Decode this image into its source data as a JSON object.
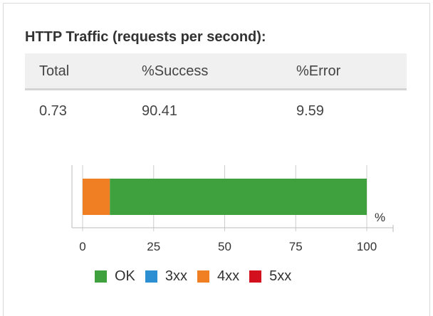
{
  "title": "HTTP Traffic (requests per second):",
  "table": {
    "headers": [
      "Total",
      "%Success",
      "%Error"
    ],
    "row": [
      "0.73",
      "90.41",
      "9.59"
    ]
  },
  "chart_data": {
    "type": "bar",
    "orientation": "horizontal",
    "stacked": true,
    "xlim": [
      0,
      100
    ],
    "x_ticks": [
      "0",
      "25",
      "50",
      "75",
      "100"
    ],
    "unit_label": "%",
    "series": [
      {
        "name": "4xx",
        "values": [
          9.59
        ],
        "color": "#ef7f22"
      },
      {
        "name": "OK",
        "values": [
          90.41
        ],
        "color": "#3fa03e"
      }
    ],
    "legend": [
      {
        "name": "OK",
        "color": "#3fa03e"
      },
      {
        "name": "3xx",
        "color": "#2b8fd1"
      },
      {
        "name": "4xx",
        "color": "#ef7f22"
      },
      {
        "name": "5xx",
        "color": "#d2101e"
      }
    ],
    "legend_position": "bottom",
    "grid": true
  }
}
